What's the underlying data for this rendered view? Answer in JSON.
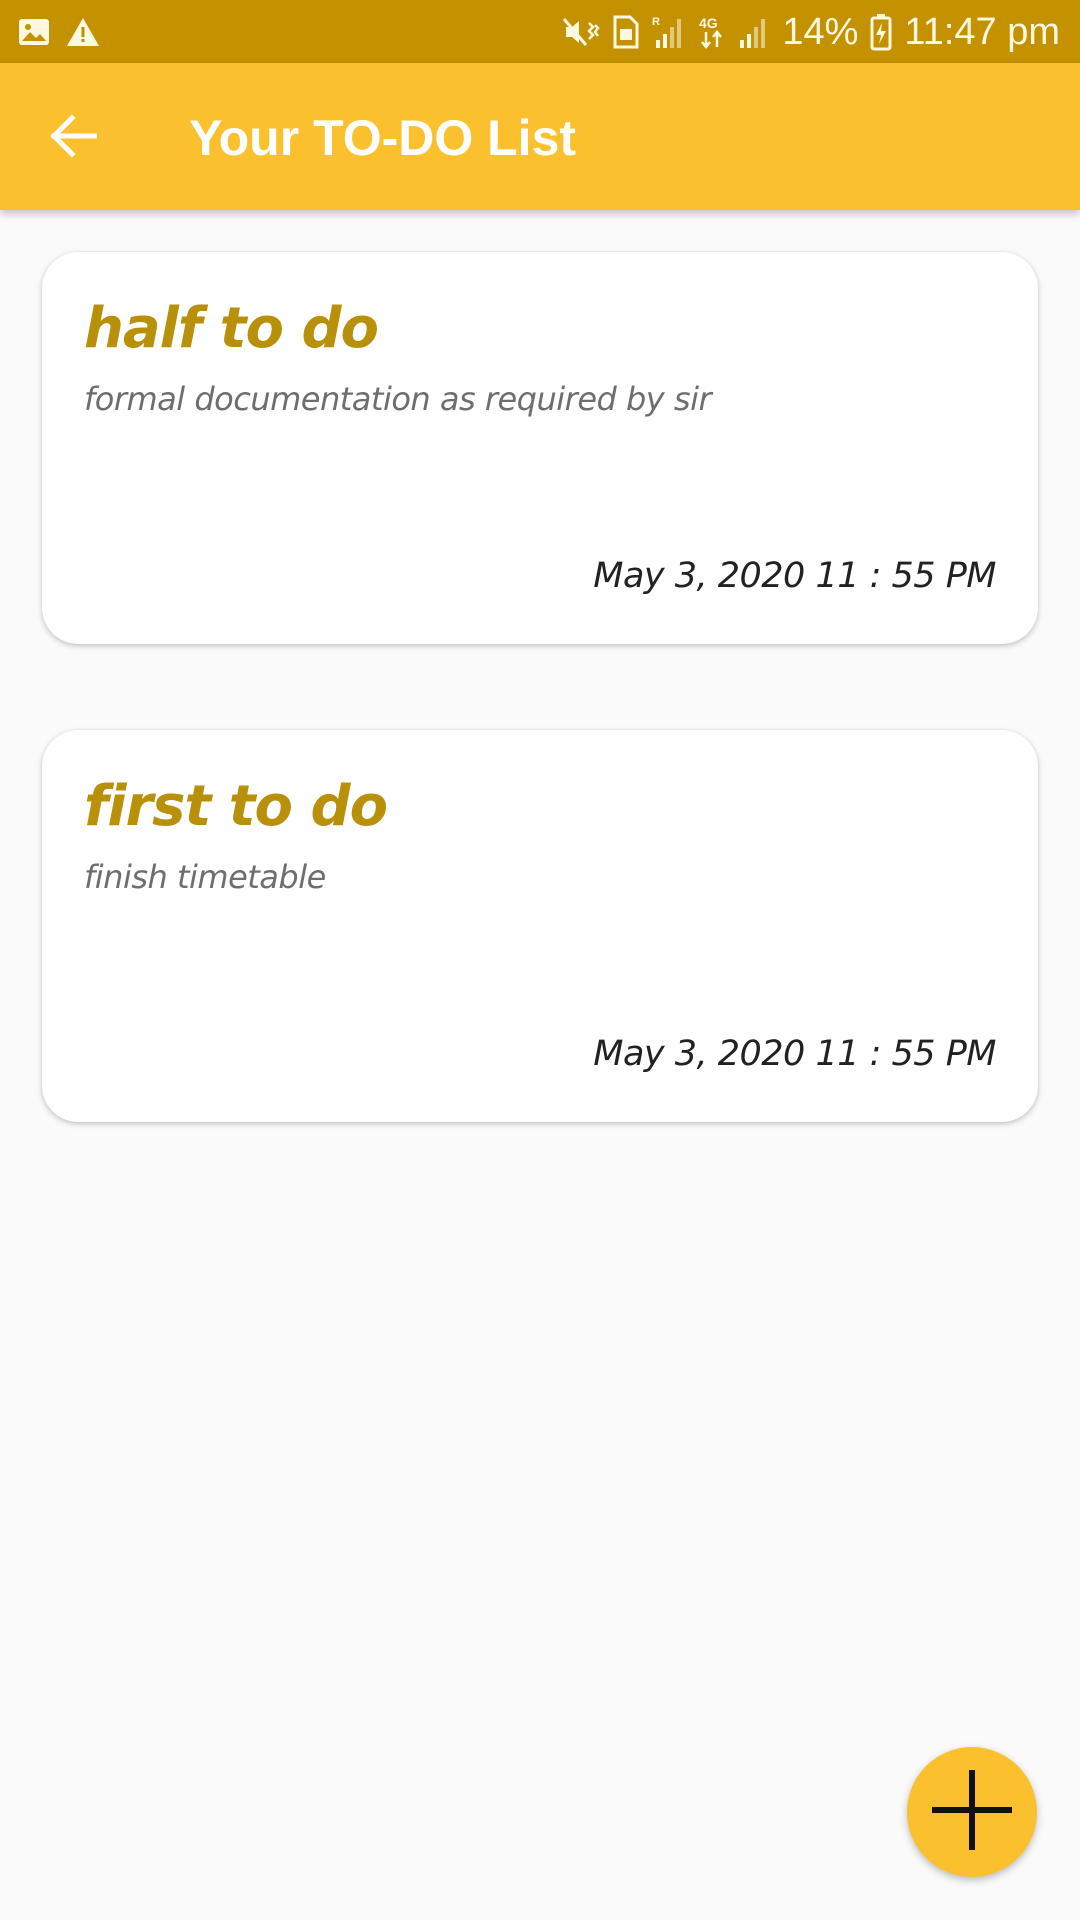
{
  "status_bar": {
    "battery": "14%",
    "time": "11:47 pm",
    "icons": [
      "gallery-icon",
      "warning-icon",
      "mute-vibrate-icon",
      "sim-icon",
      "roaming-signal-icon",
      "4g-data-icon",
      "signal-icon",
      "battery-charging-icon"
    ]
  },
  "app_bar": {
    "title": "Your TO-DO List",
    "back_icon": "arrow-back-icon"
  },
  "todos": [
    {
      "title": "half to do",
      "description": "formal documentation as required by sir",
      "datetime": "May 3, 2020  11 : 55 PM"
    },
    {
      "title": "first to do",
      "description": "finish timetable",
      "datetime": "May 3, 2020  11 : 55 PM"
    }
  ],
  "fab": {
    "icon": "add-icon"
  },
  "colors": {
    "status_bar": "#C49100",
    "accent": "#FBC02D",
    "title_text": "#B8900A",
    "background": "#FAFAFA"
  }
}
